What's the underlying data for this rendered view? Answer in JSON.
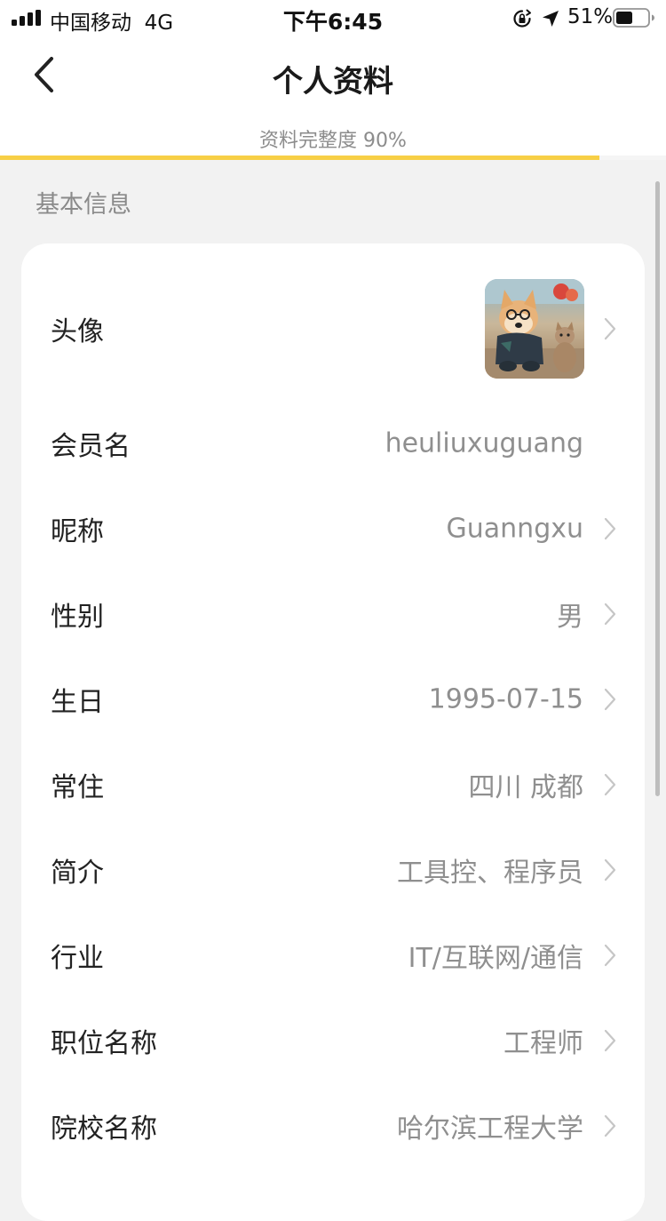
{
  "status_bar": {
    "carrier": "中国移动",
    "network": "4G",
    "time": "下午6:45",
    "battery": "51%"
  },
  "header": {
    "title": "个人资料",
    "completeness_label": "资料完整度 90%",
    "completeness_fraction": 0.9
  },
  "section": {
    "title": "基本信息"
  },
  "rows": [
    {
      "label": "头像",
      "value": "",
      "type": "avatar"
    },
    {
      "label": "会员名",
      "value": "heuliuxuguang",
      "type": "static"
    },
    {
      "label": "昵称",
      "value": "Guanngxu",
      "type": "link"
    },
    {
      "label": "性别",
      "value": "男",
      "type": "link"
    },
    {
      "label": "生日",
      "value": "1995-07-15",
      "type": "link"
    },
    {
      "label": "常住",
      "value": "四川 成都",
      "type": "link"
    },
    {
      "label": "简介",
      "value": "工具控、程序员",
      "type": "link"
    },
    {
      "label": "行业",
      "value": "IT/互联网/通信",
      "type": "link"
    },
    {
      "label": "职位名称",
      "value": "工程师",
      "type": "link"
    },
    {
      "label": "院校名称",
      "value": "哈尔滨工程大学",
      "type": "link"
    }
  ],
  "colors": {
    "accent": "#f7cf46",
    "background": "#f2f2f2",
    "card": "#ffffff",
    "label": "#222222",
    "value": "#8f8f8f"
  },
  "icons": {
    "back": "chevron-left-icon",
    "row_arrow": "chevron-right-icon",
    "avatar": "dog-and-cat-photo"
  }
}
